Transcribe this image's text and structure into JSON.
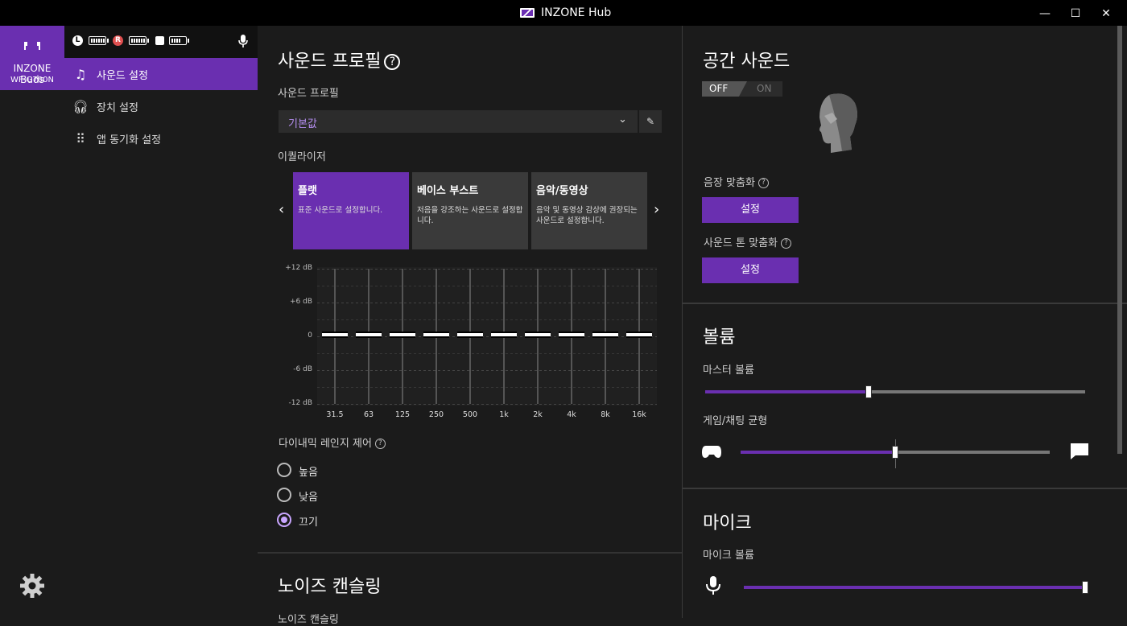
{
  "window": {
    "title": "INZONE Hub",
    "controls": {
      "minimize": "—",
      "maximize": "☐",
      "close": "✕"
    }
  },
  "device": {
    "name": "INZONE Buds",
    "model": "WF-G700N",
    "icon": "earbuds-icon"
  },
  "status": {
    "left_badge": "L",
    "right_badge": "R",
    "left_battery_pct": 100,
    "right_battery_pct": 100,
    "case_battery_pct": 70,
    "icons": [
      "left-bud-icon",
      "battery-icon",
      "right-bud-icon",
      "battery-icon",
      "case-icon",
      "battery-icon",
      "mic-icon"
    ]
  },
  "nav": [
    {
      "label": "사운드 설정",
      "icon": "music-note-icon",
      "active": true
    },
    {
      "label": "장치 설정",
      "icon": "headphones-icon",
      "active": false
    },
    {
      "label": "앱 동기화 설정",
      "icon": "grid-icon",
      "active": false
    }
  ],
  "sound_profile": {
    "heading": "사운드 프로필",
    "label": "사운드 프로필",
    "selected": "기본값",
    "equalizer_label": "이퀄라이저",
    "presets": [
      {
        "title": "플랫",
        "desc": "표준 사운드로 설정합니다.",
        "selected": true
      },
      {
        "title": "베이스 부스트",
        "desc": "저음을 강조하는 사운드로 설정합니다.",
        "selected": false
      },
      {
        "title": "음악/동영상",
        "desc": "음악 및 동영상 감상에 권장되는 사운드로 설정합니다.",
        "selected": false
      }
    ],
    "eq": {
      "db_labels": [
        "+12 dB",
        "+6 dB",
        "0",
        "-6 dB",
        "-12 dB"
      ],
      "bands": [
        "31.5",
        "63",
        "125",
        "250",
        "500",
        "1k",
        "2k",
        "4k",
        "8k",
        "16k"
      ],
      "gains_db": [
        0,
        0,
        0,
        0,
        0,
        0,
        0,
        0,
        0,
        0
      ],
      "range_db": [
        -12,
        12
      ]
    },
    "dynamic_range": {
      "label": "다이내믹 레인지 제어",
      "options": [
        "높음",
        "낮음",
        "끄기"
      ],
      "selected": "끄기"
    }
  },
  "noise": {
    "heading": "노이즈 캔슬링",
    "sub": "노이즈 캔슬링"
  },
  "spatial": {
    "heading": "공간 사운드",
    "toggle_off": "OFF",
    "toggle_on": "ON",
    "state": "OFF",
    "field_label": "음장 맞춤화",
    "field_button": "설정",
    "tone_label": "사운드 톤 맞춤화",
    "tone_button": "설정"
  },
  "volume": {
    "heading": "볼륨",
    "master_label": "마스터 볼륨",
    "master_pct": 43,
    "balance_label": "게임/채팅 균형",
    "balance_pct": 50
  },
  "mic": {
    "heading": "마이크",
    "volume_label": "마이크 볼륨",
    "volume_pct": 100
  },
  "colors": {
    "accent": "#6a2fb0",
    "accent_light": "#c9a6ff",
    "bg": "#1b1b1b"
  }
}
